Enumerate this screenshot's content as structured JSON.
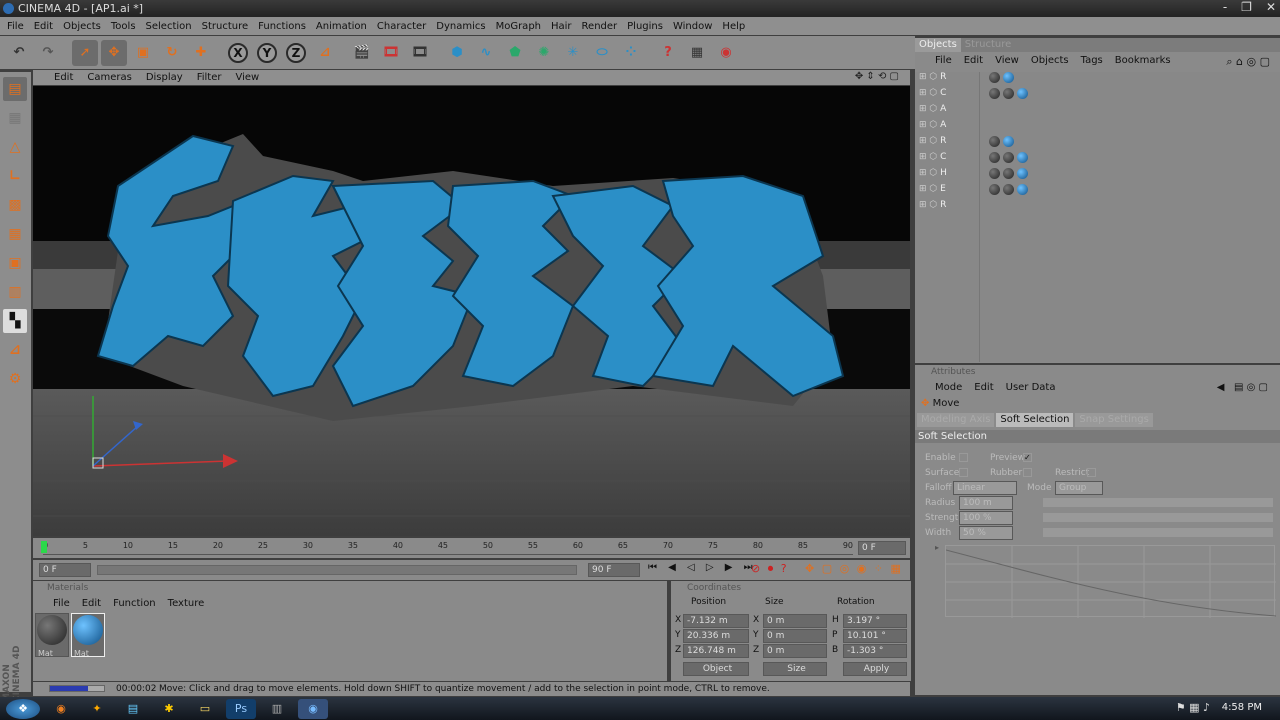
{
  "window": {
    "title": "CINEMA 4D - [AP1.ai *]",
    "controls": [
      "-",
      "❐",
      "✕"
    ]
  },
  "menubar": [
    "File",
    "Edit",
    "Objects",
    "Tools",
    "Selection",
    "Structure",
    "Functions",
    "Animation",
    "Character",
    "Dynamics",
    "MoGraph",
    "Hair",
    "Render",
    "Plugins",
    "Window",
    "Help"
  ],
  "viewport": {
    "menu": [
      "Edit",
      "Cameras",
      "Display",
      "Filter",
      "View"
    ],
    "artwork_text": "ARCHER"
  },
  "timeline": {
    "ticks": [
      "0",
      "5",
      "10",
      "15",
      "20",
      "25",
      "30",
      "35",
      "40",
      "45",
      "50",
      "55",
      "60",
      "65",
      "70",
      "75",
      "80",
      "85",
      "90"
    ],
    "end_field": "0 F",
    "start_field": "0 F",
    "max_field": "90 F"
  },
  "materials": {
    "title": "Materials",
    "menu": [
      "File",
      "Edit",
      "Function",
      "Texture"
    ],
    "items": [
      "Mat",
      "Mat"
    ]
  },
  "coordinates": {
    "title": "Coordinates",
    "headers": [
      "Position",
      "Size",
      "Rotation"
    ],
    "rows": [
      {
        "axis": "X",
        "pos": "-7.132 m",
        "size_axis": "X",
        "size": "0 m",
        "rot_axis": "H",
        "rot": "3.197 °"
      },
      {
        "axis": "Y",
        "pos": "20.336 m",
        "size_axis": "Y",
        "size": "0 m",
        "rot_axis": "P",
        "rot": "10.101 °"
      },
      {
        "axis": "Z",
        "pos": "126.748 m",
        "size_axis": "Z",
        "size": "0 m",
        "rot_axis": "B",
        "rot": "-1.303 °"
      }
    ],
    "mode_select": "Object",
    "size_select": "Size",
    "apply": "Apply"
  },
  "status": {
    "time": "00:00:02",
    "message": "Move: Click and drag to move elements. Hold down SHIFT to quantize movement / add to the selection in point mode, CTRL to remove."
  },
  "objects_panel": {
    "tabs": [
      "Objects",
      "Structure"
    ],
    "menu": [
      "File",
      "Edit",
      "View",
      "Objects",
      "Tags",
      "Bookmarks"
    ],
    "rows": [
      "R",
      "C",
      "A",
      "A",
      "R",
      "C",
      "H",
      "E",
      "R"
    ]
  },
  "attributes_panel": {
    "title": "Attributes",
    "menu": [
      "Mode",
      "Edit",
      "User Data"
    ],
    "tool_name": "Move",
    "tabs": [
      "Modeling Axis",
      "Soft Selection",
      "Snap Settings"
    ],
    "section": "Soft Selection",
    "labels": {
      "enable": "Enable",
      "preview": "Preview",
      "surface": "Surface",
      "rubber": "Rubber",
      "restrict": "Restrict",
      "falloff": "Falloff",
      "falloff_val": "Linear",
      "mode": "Mode",
      "mode_val": "Group",
      "radius": "Radius",
      "radius_val": "100 m",
      "strength": "Strength",
      "strength_val": "100 %",
      "width": "Width",
      "width_val": "50 %"
    }
  },
  "taskbar": {
    "clock": "4:58 PM"
  },
  "colors": {
    "accent_blue": "#2b8fc7",
    "panel": "#8a8a8a",
    "viewport_bg": "#050505"
  }
}
